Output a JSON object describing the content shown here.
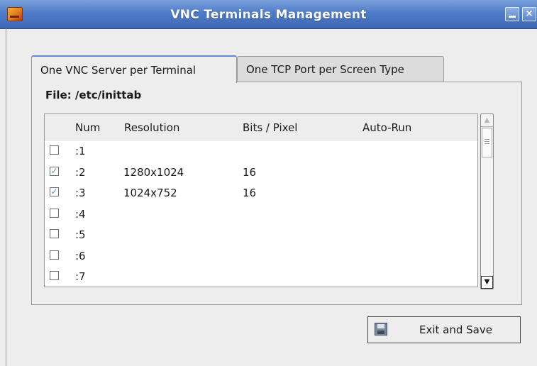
{
  "window": {
    "title": "VNC Terminals Management",
    "min_symbol": "",
    "close_symbol": "×"
  },
  "tabs": [
    {
      "label": "One VNC Server per Terminal",
      "active": true
    },
    {
      "label": "One TCP Port per Screen Type",
      "active": false
    }
  ],
  "file_label": "File: /etc/inittab",
  "table": {
    "columns": [
      "Num",
      "Resolution",
      "Bits / Pixel",
      "Auto-Run"
    ],
    "rows": [
      {
        "checked": false,
        "num": ":1",
        "resolution": "",
        "bits": "",
        "auto_run": ""
      },
      {
        "checked": true,
        "num": ":2",
        "resolution": "1280x1024",
        "bits": "16",
        "auto_run": ""
      },
      {
        "checked": true,
        "num": ":3",
        "resolution": "1024x752",
        "bits": "16",
        "auto_run": ""
      },
      {
        "checked": false,
        "num": ":4",
        "resolution": "",
        "bits": "",
        "auto_run": ""
      },
      {
        "checked": false,
        "num": ":5",
        "resolution": "",
        "bits": "",
        "auto_run": ""
      },
      {
        "checked": false,
        "num": ":6",
        "resolution": "",
        "bits": "",
        "auto_run": ""
      },
      {
        "checked": false,
        "num": ":7",
        "resolution": "",
        "bits": "",
        "auto_run": ""
      }
    ]
  },
  "scrollbar": {
    "up_arrow": "▲",
    "down_arrow": "▼"
  },
  "buttons": {
    "exit_save": "Exit and Save"
  },
  "icons": {
    "app": "vnc-app-icon",
    "save": "floppy-disk-icon"
  },
  "colors": {
    "titlebar": "#4f7cc8",
    "accent": "#5d8bd0",
    "background": "#ededed"
  }
}
